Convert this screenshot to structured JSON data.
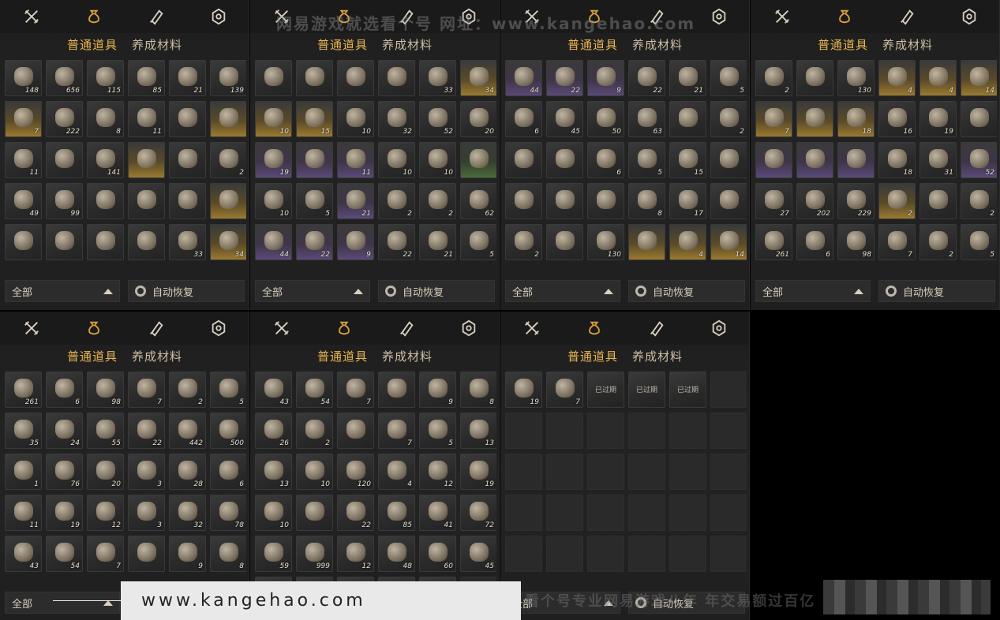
{
  "top_icons": [
    "crossed-swords-icon",
    "pouch-icon",
    "scroll-icon",
    "badge-icon"
  ],
  "tabs": {
    "common": "普通道具",
    "materials": "养成材料"
  },
  "bottom": {
    "filter": "全部",
    "restore": "自动恢复"
  },
  "panels": [
    {
      "active_tab": "common",
      "slots": [
        {
          "c": "148",
          "t": ""
        },
        {
          "c": "656",
          "t": ""
        },
        {
          "c": "115",
          "t": ""
        },
        {
          "c": "85",
          "t": ""
        },
        {
          "c": "21",
          "t": ""
        },
        {
          "c": "139",
          "t": ""
        },
        {
          "c": "7",
          "t": "gold"
        },
        {
          "c": "222",
          "t": ""
        },
        {
          "c": "8",
          "t": ""
        },
        {
          "c": "11",
          "t": ""
        },
        {
          "c": "",
          "t": ""
        },
        {
          "c": "",
          "t": "gold"
        },
        {
          "c": "11",
          "t": ""
        },
        {
          "c": "",
          "t": ""
        },
        {
          "c": "141",
          "t": ""
        },
        {
          "c": "",
          "t": "gold"
        },
        {
          "c": "",
          "t": ""
        },
        {
          "c": "2",
          "t": ""
        },
        {
          "c": "49",
          "t": ""
        },
        {
          "c": "99",
          "t": ""
        },
        {
          "c": "",
          "t": ""
        },
        {
          "c": "",
          "t": ""
        },
        {
          "c": "",
          "t": ""
        },
        {
          "c": "",
          "t": "gold"
        },
        {
          "c": "",
          "t": ""
        },
        {
          "c": "",
          "t": ""
        },
        {
          "c": "",
          "t": ""
        },
        {
          "c": "",
          "t": ""
        },
        {
          "c": "33",
          "t": ""
        },
        {
          "c": "34",
          "t": "gold"
        }
      ]
    },
    {
      "active_tab": "common",
      "slots": [
        {
          "c": "",
          "t": ""
        },
        {
          "c": "",
          "t": ""
        },
        {
          "c": "",
          "t": ""
        },
        {
          "c": "",
          "t": ""
        },
        {
          "c": "33",
          "t": ""
        },
        {
          "c": "34",
          "t": "gold"
        },
        {
          "c": "10",
          "t": "gold"
        },
        {
          "c": "15",
          "t": "gold"
        },
        {
          "c": "10",
          "t": ""
        },
        {
          "c": "32",
          "t": ""
        },
        {
          "c": "52",
          "t": ""
        },
        {
          "c": "20",
          "t": ""
        },
        {
          "c": "19",
          "t": "purple"
        },
        {
          "c": "",
          "t": "purple"
        },
        {
          "c": "11",
          "t": "purple"
        },
        {
          "c": "10",
          "t": ""
        },
        {
          "c": "10",
          "t": ""
        },
        {
          "c": "",
          "t": "green"
        },
        {
          "c": "10",
          "t": ""
        },
        {
          "c": "5",
          "t": ""
        },
        {
          "c": "21",
          "t": "purple"
        },
        {
          "c": "2",
          "t": ""
        },
        {
          "c": "2",
          "t": ""
        },
        {
          "c": "62",
          "t": ""
        },
        {
          "c": "44",
          "t": "purple"
        },
        {
          "c": "22",
          "t": "purple"
        },
        {
          "c": "9",
          "t": "purple"
        },
        {
          "c": "22",
          "t": ""
        },
        {
          "c": "21",
          "t": ""
        },
        {
          "c": "5",
          "t": ""
        }
      ]
    },
    {
      "active_tab": "common",
      "slots": [
        {
          "c": "44",
          "t": "purple"
        },
        {
          "c": "22",
          "t": "purple"
        },
        {
          "c": "9",
          "t": "purple"
        },
        {
          "c": "22",
          "t": ""
        },
        {
          "c": "21",
          "t": ""
        },
        {
          "c": "5",
          "t": ""
        },
        {
          "c": "6",
          "t": ""
        },
        {
          "c": "45",
          "t": ""
        },
        {
          "c": "50",
          "t": ""
        },
        {
          "c": "63",
          "t": ""
        },
        {
          "c": "",
          "t": ""
        },
        {
          "c": "2",
          "t": ""
        },
        {
          "c": "",
          "t": ""
        },
        {
          "c": "",
          "t": ""
        },
        {
          "c": "6",
          "t": ""
        },
        {
          "c": "5",
          "t": ""
        },
        {
          "c": "15",
          "t": ""
        },
        {
          "c": "",
          "t": ""
        },
        {
          "c": "",
          "t": ""
        },
        {
          "c": "",
          "t": ""
        },
        {
          "c": "",
          "t": ""
        },
        {
          "c": "8",
          "t": ""
        },
        {
          "c": "17",
          "t": ""
        },
        {
          "c": "",
          "t": ""
        },
        {
          "c": "2",
          "t": ""
        },
        {
          "c": "",
          "t": ""
        },
        {
          "c": "130",
          "t": ""
        },
        {
          "c": "",
          "t": "gold"
        },
        {
          "c": "4",
          "t": "gold"
        },
        {
          "c": "14",
          "t": "gold"
        }
      ]
    },
    {
      "active_tab": "common",
      "slots": [
        {
          "c": "2",
          "t": ""
        },
        {
          "c": "",
          "t": ""
        },
        {
          "c": "130",
          "t": ""
        },
        {
          "c": "4",
          "t": "gold"
        },
        {
          "c": "4",
          "t": "gold"
        },
        {
          "c": "14",
          "t": "gold"
        },
        {
          "c": "7",
          "t": "gold"
        },
        {
          "c": "",
          "t": "gold"
        },
        {
          "c": "18",
          "t": "gold"
        },
        {
          "c": "16",
          "t": ""
        },
        {
          "c": "19",
          "t": ""
        },
        {
          "c": "",
          "t": ""
        },
        {
          "c": "",
          "t": "purple"
        },
        {
          "c": "",
          "t": "purple"
        },
        {
          "c": "",
          "t": "purple"
        },
        {
          "c": "18",
          "t": ""
        },
        {
          "c": "31",
          "t": ""
        },
        {
          "c": "52",
          "t": "purple"
        },
        {
          "c": "27",
          "t": ""
        },
        {
          "c": "202",
          "t": ""
        },
        {
          "c": "229",
          "t": ""
        },
        {
          "c": "2",
          "t": "gold"
        },
        {
          "c": "",
          "t": ""
        },
        {
          "c": "2",
          "t": ""
        },
        {
          "c": "261",
          "t": ""
        },
        {
          "c": "6",
          "t": ""
        },
        {
          "c": "98",
          "t": ""
        },
        {
          "c": "7",
          "t": ""
        },
        {
          "c": "2",
          "t": ""
        },
        {
          "c": "5",
          "t": ""
        }
      ]
    },
    {
      "active_tab": "common",
      "slots": [
        {
          "c": "261",
          "t": ""
        },
        {
          "c": "6",
          "t": ""
        },
        {
          "c": "98",
          "t": ""
        },
        {
          "c": "7",
          "t": ""
        },
        {
          "c": "2",
          "t": ""
        },
        {
          "c": "5",
          "t": ""
        },
        {
          "c": "35",
          "t": ""
        },
        {
          "c": "24",
          "t": ""
        },
        {
          "c": "55",
          "t": ""
        },
        {
          "c": "22",
          "t": ""
        },
        {
          "c": "442",
          "t": ""
        },
        {
          "c": "500",
          "t": ""
        },
        {
          "c": "1",
          "t": ""
        },
        {
          "c": "76",
          "t": ""
        },
        {
          "c": "20",
          "t": ""
        },
        {
          "c": "3",
          "t": ""
        },
        {
          "c": "28",
          "t": ""
        },
        {
          "c": "6",
          "t": ""
        },
        {
          "c": "11",
          "t": ""
        },
        {
          "c": "19",
          "t": ""
        },
        {
          "c": "12",
          "t": ""
        },
        {
          "c": "3",
          "t": ""
        },
        {
          "c": "32",
          "t": ""
        },
        {
          "c": "78",
          "t": ""
        },
        {
          "c": "43",
          "t": ""
        },
        {
          "c": "54",
          "t": ""
        },
        {
          "c": "7",
          "t": ""
        },
        {
          "c": "",
          "t": ""
        },
        {
          "c": "9",
          "t": ""
        },
        {
          "c": "8",
          "t": ""
        }
      ]
    },
    {
      "active_tab": "common",
      "slots": [
        {
          "c": "43",
          "t": ""
        },
        {
          "c": "54",
          "t": ""
        },
        {
          "c": "7",
          "t": ""
        },
        {
          "c": "",
          "t": ""
        },
        {
          "c": "9",
          "t": ""
        },
        {
          "c": "8",
          "t": ""
        },
        {
          "c": "26",
          "t": ""
        },
        {
          "c": "2",
          "t": ""
        },
        {
          "c": "",
          "t": ""
        },
        {
          "c": "7",
          "t": ""
        },
        {
          "c": "5",
          "t": ""
        },
        {
          "c": "13",
          "t": ""
        },
        {
          "c": "13",
          "t": ""
        },
        {
          "c": "10",
          "t": ""
        },
        {
          "c": "120",
          "t": ""
        },
        {
          "c": "4",
          "t": ""
        },
        {
          "c": "12",
          "t": ""
        },
        {
          "c": "19",
          "t": ""
        },
        {
          "c": "10",
          "t": ""
        },
        {
          "c": "",
          "t": ""
        },
        {
          "c": "22",
          "t": ""
        },
        {
          "c": "85",
          "t": ""
        },
        {
          "c": "41",
          "t": ""
        },
        {
          "c": "72",
          "t": ""
        },
        {
          "c": "59",
          "t": ""
        },
        {
          "c": "999",
          "t": ""
        },
        {
          "c": "12",
          "t": ""
        },
        {
          "c": "48",
          "t": ""
        },
        {
          "c": "60",
          "t": ""
        },
        {
          "c": "45",
          "t": ""
        },
        {
          "c": "19",
          "t": ""
        },
        {
          "c": "7",
          "t": ""
        },
        {
          "c": "",
          "t": "",
          "e": "已过期"
        },
        {
          "c": "",
          "t": "",
          "e": "已过期"
        },
        {
          "c": "",
          "t": "",
          "e": "已过期"
        },
        {
          "c": "",
          "t": "empty"
        }
      ]
    },
    {
      "active_tab": "common",
      "slots": [
        {
          "c": "19",
          "t": ""
        },
        {
          "c": "7",
          "t": ""
        },
        {
          "c": "",
          "t": "",
          "e": "已过期"
        },
        {
          "c": "",
          "t": "",
          "e": "已过期"
        },
        {
          "c": "",
          "t": "",
          "e": "已过期"
        },
        {
          "c": "",
          "t": "empty"
        },
        {
          "c": "",
          "t": "empty"
        },
        {
          "c": "",
          "t": "empty"
        },
        {
          "c": "",
          "t": "empty"
        },
        {
          "c": "",
          "t": "empty"
        },
        {
          "c": "",
          "t": "empty"
        },
        {
          "c": "",
          "t": "empty"
        },
        {
          "c": "",
          "t": "empty"
        },
        {
          "c": "",
          "t": "empty"
        },
        {
          "c": "",
          "t": "empty"
        },
        {
          "c": "",
          "t": "empty"
        },
        {
          "c": "",
          "t": "empty"
        },
        {
          "c": "",
          "t": "empty"
        },
        {
          "c": "",
          "t": "empty"
        },
        {
          "c": "",
          "t": "empty"
        },
        {
          "c": "",
          "t": "empty"
        },
        {
          "c": "",
          "t": "empty"
        },
        {
          "c": "",
          "t": "empty"
        },
        {
          "c": "",
          "t": "empty"
        },
        {
          "c": "",
          "t": "empty"
        },
        {
          "c": "",
          "t": "empty"
        },
        {
          "c": "",
          "t": "empty"
        },
        {
          "c": "",
          "t": "empty"
        },
        {
          "c": "",
          "t": "empty"
        },
        {
          "c": "",
          "t": "empty"
        }
      ]
    }
  ],
  "watermarks": {
    "top": "网易游戏就选看个号  网址：www.kangehao.com",
    "footer_url": "www.kangehao.com",
    "bottom": "看个号专业网易游戏八年  年交易额过百亿"
  },
  "colors": {
    "accent": "#e9b552",
    "panel_bg": "#1e1e1e",
    "slot_bg": "#2e2e2e"
  }
}
